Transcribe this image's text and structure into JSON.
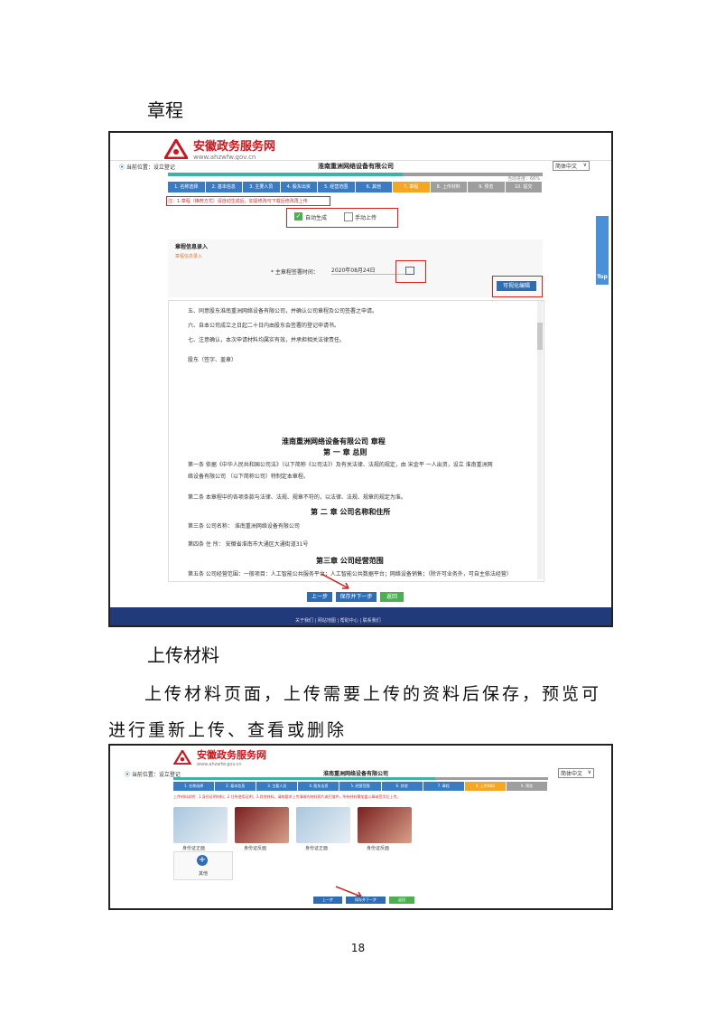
{
  "section1": {
    "heading": "章程"
  },
  "shot1": {
    "logo_name": "安徽政务服务网",
    "logo_url": "www.ahzwfw.gov.cn",
    "location": "当前位置：设立登记",
    "company_title": "淮南重洲网络设备有限公司",
    "lang_select": "简体中文",
    "progress_label": "当前进度：66%",
    "steps": [
      "1. 名称选择",
      "2. 基本信息",
      "3. 主要人员",
      "4. 股东出资",
      "5. 经营范围",
      "6. 其他",
      "7. 章程",
      "8. 上传材料",
      "9. 预览",
      "10. 提交"
    ],
    "notice": "注：1.章程（推荐方式）请自动生成后，如需修改可下载后修改再上传",
    "option_auto": "自动生成",
    "option_manual": "手动上传",
    "panel_title": "章程信息录入",
    "panel_note": "章程信息录入",
    "sign_label": "* 主章程签署时间：",
    "sign_value": "2020年08月24日",
    "generate_button": "可视化编辑",
    "doc_lines": {
      "l1": "五、同意股东淮南重洲网络设备有限公司，并确认公司章程及公司签署之申请。",
      "l2": "六、自本公司成立之日起二十日内由股东会签署的登记申请书。",
      "l3": "七、注意确认，本次申请材料均属实有效，并承担相关法律责任。",
      "l4": "股东（签字、盖章）",
      "title": "淮南重洲网络设备有限公司 章程",
      "ch1": "第  一  章  总则",
      "a1": "第一条  依据《中华人民共和国公司法》（以下简称《公司法》）及有关法律、法规的规定，由 宋金平 一人出资，设立 淮南重洲网",
      "a1b": "络设备有限公司 （以下简称公司）特制定本章程。",
      "a2": "第二条  本章程中的各项条款与法律、法规、规章不符的，以法律、法规、规章的规定为准。",
      "ch2": "第  二  章  公司名称和住所",
      "a3": "第三条  公司名称：  淮南重洲网络设备有限公司",
      "a4": "第四条  住       所：  安徽省淮南市大通区大通街道31号",
      "ch3": "第三章  公司经营范围",
      "a5": "第五条  公司经营范围：一般项目：人工智能公共服务平台；人工智能公共数据平台；网络设备销售；（除许可业务外，可自主依法经营）"
    },
    "btn_prev": "上一步",
    "btn_save_next": "保存并下一步",
    "btn_back": "返回",
    "footer_text": "关于我们  |  网站地图  |  帮助中心  |  联系我们",
    "side_tab": "Top"
  },
  "section2": {
    "heading": "上传材料",
    "paragraph": "上传材料页面，上传需要上传的资料后保存，预览可进行重新上传、查看或删除"
  },
  "shot2": {
    "logo_name": "安徽政务服务网",
    "logo_url": "www.ahzwfw.gov.cn",
    "location": "当前位置：设立登记",
    "company_title": "淮南重洲网络设备有限公司",
    "lang_select": "简体中文",
    "steps": [
      "1. 名称选择",
      "2. 基本信息",
      "3. 主要人员",
      "4. 股东出资",
      "5. 经营范围",
      "6. 其他",
      "7. 章程",
      "8. 上传材料",
      "9. 预览"
    ],
    "notice": "上传材料说明：1.身份证明材料；2.住所使用证明；3.其他材料。请按要求上传清晰的材料照片或扫描件，所有材料需加盖公章或签字后上传。",
    "thumb_captions": [
      "身份证正面",
      "身份证反面",
      "身份证正面",
      "身份证反面"
    ],
    "add_label": "其他",
    "btn_prev": "上一步",
    "btn_save_next": "保存并下一步",
    "btn_back": "返回"
  },
  "page_number": "18",
  "colors": {
    "brand_red": "#d0141b",
    "teal": "#3bb3a8",
    "navy": "#203a7a",
    "blue": "#2e6db4",
    "green": "#4caf50",
    "grey": "#9e9e9e",
    "orange": "#f5a623"
  }
}
